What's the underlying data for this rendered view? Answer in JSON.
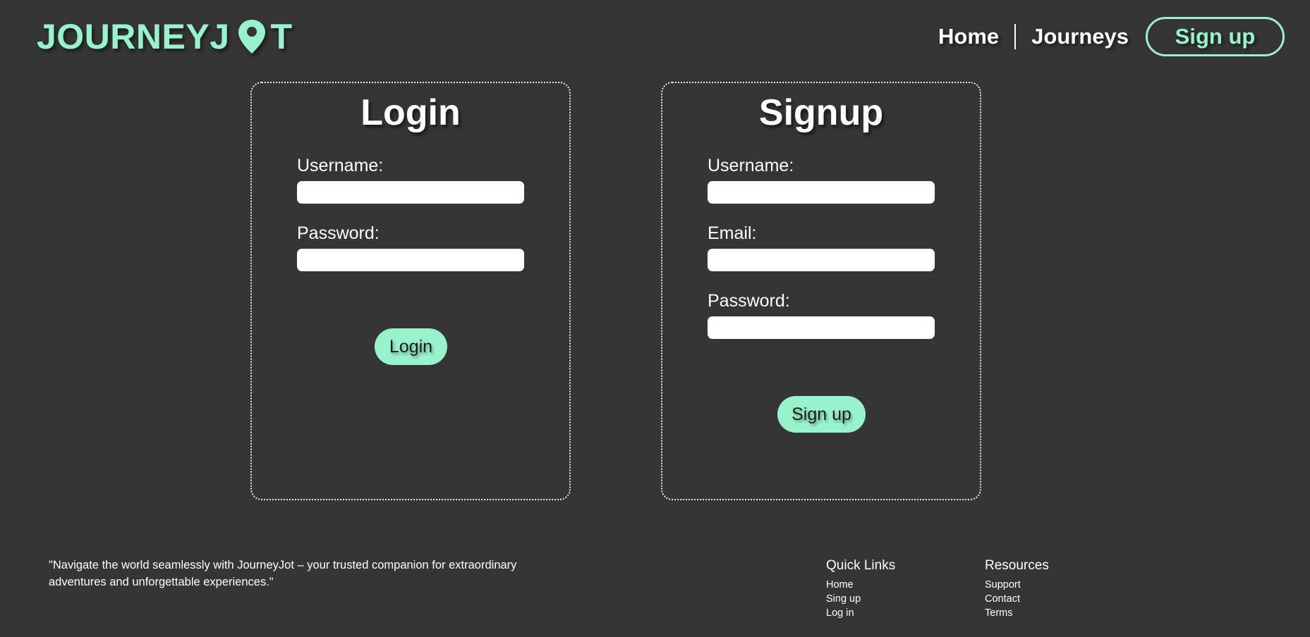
{
  "brand": {
    "logo_left": "JOURNEYJ",
    "logo_right": "T",
    "accent_color": "#98f3cc",
    "background_color": "#353535"
  },
  "nav": {
    "home": "Home",
    "journeys": "Journeys",
    "signup": "Sign up"
  },
  "login": {
    "title": "Login",
    "username_label": "Username:",
    "username_value": "",
    "password_label": "Password:",
    "password_value": "",
    "button": "Login"
  },
  "signup": {
    "title": "Signup",
    "username_label": "Username:",
    "username_value": "",
    "email_label": "Email:",
    "email_value": "",
    "password_label": "Password:",
    "password_value": "",
    "button": "Sign up"
  },
  "footer": {
    "quote": "\"Navigate the world seamlessly with JourneyJot – your trusted companion for extraordinary adventures and unforgettable experiences.\"",
    "quick_links": {
      "heading": "Quick Links",
      "items": [
        "Home",
        "Sing up",
        "Log in"
      ]
    },
    "resources": {
      "heading": "Resources",
      "items": [
        "Support",
        "Contact",
        "Terms"
      ]
    }
  },
  "icons": {
    "logo_pin": "map-pin-icon"
  }
}
